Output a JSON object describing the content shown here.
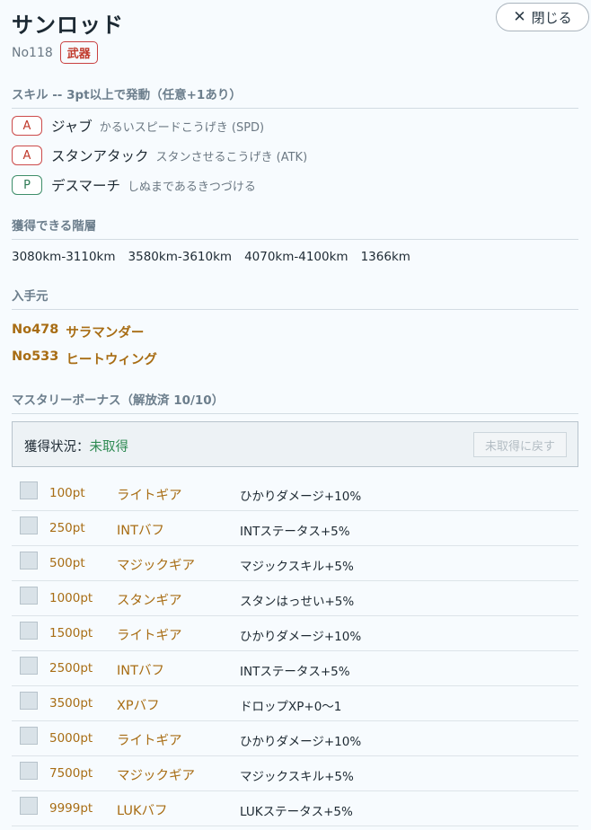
{
  "header": {
    "title": "サンロッド",
    "close_label": "閉じる",
    "number": "No118",
    "category_badge": "武器"
  },
  "skills": {
    "heading": "スキル -- 3pt以上で発動（任意+1あり）",
    "items": [
      {
        "type": "A",
        "name": "ジャブ",
        "desc": "かるいスピードこうげき (SPD)"
      },
      {
        "type": "A",
        "name": "スタンアタック",
        "desc": "スタンさせるこうげき (ATK)"
      },
      {
        "type": "P",
        "name": "デスマーチ",
        "desc": "しぬまであるきつづける"
      }
    ]
  },
  "floors": {
    "heading": "獲得できる階層",
    "items": [
      "3080km-3110km",
      "3580km-3610km",
      "4070km-4100km",
      "1366km"
    ]
  },
  "sources": {
    "heading": "入手元",
    "items": [
      {
        "no": "No478",
        "name": "サラマンダー"
      },
      {
        "no": "No533",
        "name": "ヒートウィング"
      }
    ]
  },
  "mastery": {
    "heading": "マスタリーボーナス（解放済 10/10）",
    "status_label": "獲得状況：",
    "status_value": "未取得",
    "reset_label": "未取得に戻す",
    "rows": [
      {
        "pt": "100pt",
        "name": "ライトギア",
        "effect": "ひかりダメージ+10%"
      },
      {
        "pt": "250pt",
        "name": "INTバフ",
        "effect": "INTステータス+5%"
      },
      {
        "pt": "500pt",
        "name": "マジックギア",
        "effect": "マジックスキル+5%"
      },
      {
        "pt": "1000pt",
        "name": "スタンギア",
        "effect": "スタンはっせい+5%"
      },
      {
        "pt": "1500pt",
        "name": "ライトギア",
        "effect": "ひかりダメージ+10%"
      },
      {
        "pt": "2500pt",
        "name": "INTバフ",
        "effect": "INTステータス+5%"
      },
      {
        "pt": "3500pt",
        "name": "XPバフ",
        "effect": "ドロップXP+0〜1"
      },
      {
        "pt": "5000pt",
        "name": "ライトギア",
        "effect": "ひかりダメージ+10%"
      },
      {
        "pt": "7500pt",
        "name": "マジックギア",
        "effect": "マジックスキル+5%"
      },
      {
        "pt": "9999pt",
        "name": "LUKバフ",
        "effect": "LUKステータス+5%"
      }
    ]
  }
}
